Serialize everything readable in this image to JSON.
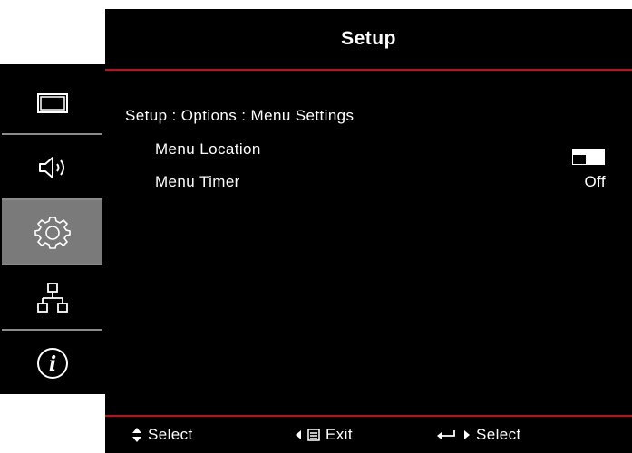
{
  "header": {
    "title": "Setup"
  },
  "menu": {
    "breadcrumb": "Setup : Options : Menu Settings",
    "rows": [
      {
        "label": "Menu Location",
        "value_icon": "menu-location-icon"
      },
      {
        "label": "Menu Timer",
        "value": "Off"
      }
    ]
  },
  "sidebar": {
    "items": [
      {
        "name": "display",
        "icon": "display-icon"
      },
      {
        "name": "audio",
        "icon": "speaker-icon"
      },
      {
        "name": "setup",
        "icon": "gear-icon",
        "active": true
      },
      {
        "name": "network",
        "icon": "network-icon"
      },
      {
        "name": "info",
        "icon": "info-icon"
      }
    ]
  },
  "footer": {
    "select_label": "Select",
    "exit_label": "Exit",
    "enter_select_label": "Select"
  },
  "colors": {
    "background": "#000000",
    "accent": "#c0101a",
    "active": "#7a7a7a"
  }
}
